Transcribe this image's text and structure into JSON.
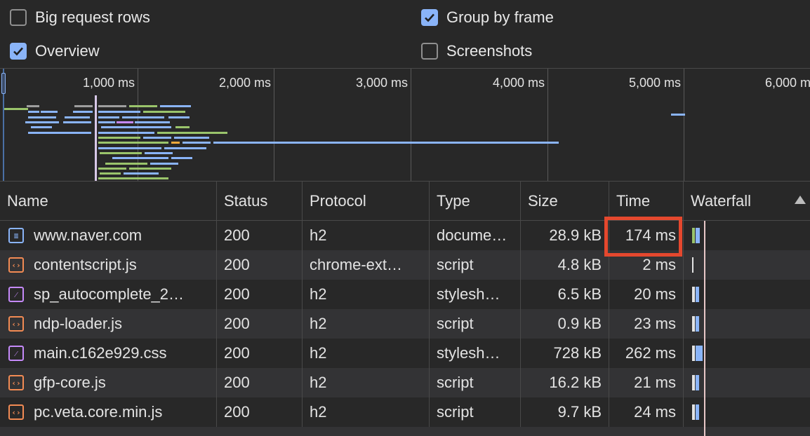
{
  "options": {
    "big_request_rows": {
      "label": "Big request rows",
      "checked": false
    },
    "group_by_frame": {
      "label": "Group by frame",
      "checked": true
    },
    "overview": {
      "label": "Overview",
      "checked": true
    },
    "screenshots": {
      "label": "Screenshots",
      "checked": false
    }
  },
  "overview_ticks": [
    "1,000 ms",
    "2,000 ms",
    "3,000 ms",
    "4,000 ms",
    "5,000 ms",
    "6,000 ms"
  ],
  "table": {
    "columns": [
      "Name",
      "Status",
      "Protocol",
      "Type",
      "Size",
      "Time",
      "Waterfall"
    ],
    "rows": [
      {
        "name": "www.naver.com",
        "icon": "document-icon",
        "status": "200",
        "protocol": "h2",
        "type": "docume…",
        "size": "28.9 kB",
        "time": "174 ms"
      },
      {
        "name": "contentscript.js",
        "icon": "script-icon",
        "status": "200",
        "protocol": "chrome-ext…",
        "type": "script",
        "size": "4.8 kB",
        "time": "2 ms"
      },
      {
        "name": "sp_autocomplete_2…",
        "icon": "stylesheet-icon",
        "status": "200",
        "protocol": "h2",
        "type": "stylesh…",
        "size": "6.5 kB",
        "time": "20 ms"
      },
      {
        "name": "ndp-loader.js",
        "icon": "script-icon",
        "status": "200",
        "protocol": "h2",
        "type": "script",
        "size": "0.9 kB",
        "time": "23 ms"
      },
      {
        "name": "main.c162e929.css",
        "icon": "stylesheet-icon",
        "status": "200",
        "protocol": "h2",
        "type": "stylesh…",
        "size": "728 kB",
        "time": "262 ms"
      },
      {
        "name": "gfp-core.js",
        "icon": "script-icon",
        "status": "200",
        "protocol": "h2",
        "type": "script",
        "size": "16.2 kB",
        "time": "21 ms"
      },
      {
        "name": "pc.veta.core.min.js",
        "icon": "script-icon",
        "status": "200",
        "protocol": "h2",
        "type": "script",
        "size": "9.7 kB",
        "time": "24 ms"
      }
    ]
  },
  "colors": {
    "accent": "#8ab4f8",
    "highlight": "#e5482e",
    "script": "#f28b54",
    "stylesheet": "#c58af9"
  }
}
